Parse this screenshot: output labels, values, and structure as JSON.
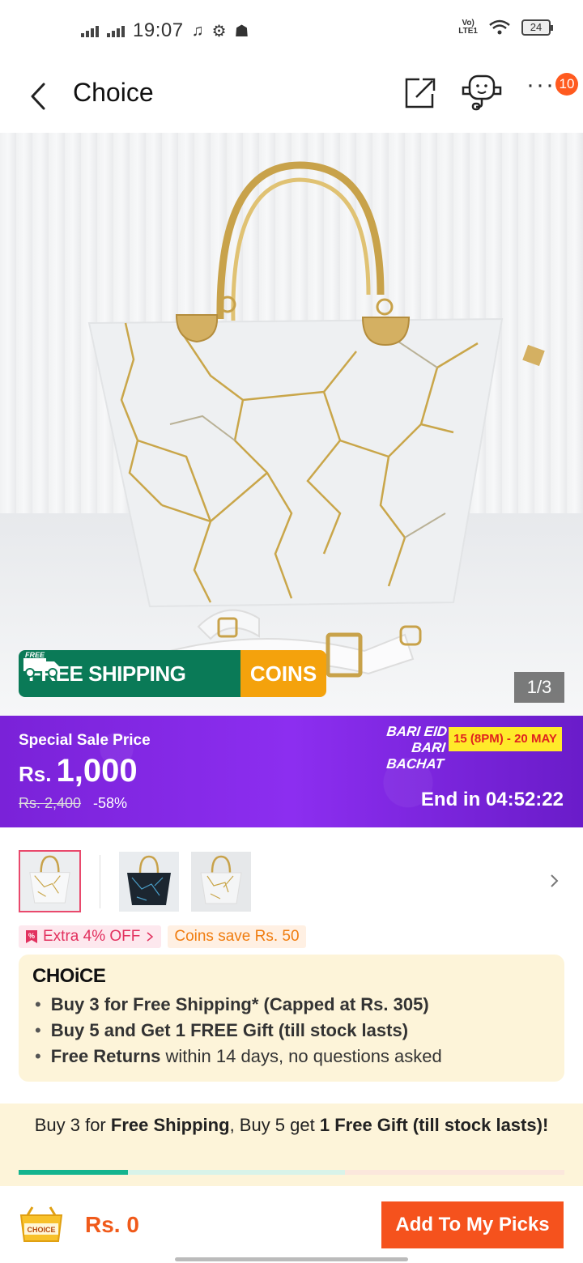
{
  "status_bar": {
    "time": "19:07",
    "network": "Vo)) LTE1",
    "battery": "24"
  },
  "header": {
    "title": "Choice",
    "notification_count": "10"
  },
  "gallery": {
    "counter": "1/3",
    "shipping_badge": {
      "tag": "FREE",
      "label": "FREE SHIPPING",
      "coins": "COINS"
    }
  },
  "sale": {
    "label": "Special Sale Price",
    "currency": "Rs.",
    "price": "1,000",
    "original_price": "Rs. 2,400",
    "discount": "-58%",
    "campaign_line1": "BARI EID",
    "campaign_line2": "BARI BACHAT",
    "campaign_dates": "15 (8PM) - 20 MAY",
    "end_prefix": "End in",
    "countdown": "04:52:22"
  },
  "promo_tags": {
    "extra_off": "Extra 4% OFF",
    "coins_save": "Coins save Rs. 50"
  },
  "choice_box": {
    "logo": "CHOiCE",
    "line1_bold": "Buy 3 for  Free Shipping* (Capped at Rs. 305)",
    "line2_bold": "Buy 5 and Get 1 FREE Gift (till stock lasts)",
    "line3_bold": "Free Returns",
    "line3_rest": " within 14 days, no questions asked"
  },
  "buy_banner": {
    "part1": "Buy 3 for ",
    "part2": "Free Shipping",
    "part3": ", Buy 5 get ",
    "part4": "1 Free Gift (till stock lasts)",
    "part5": "!",
    "progress": 0.2
  },
  "bottom_bar": {
    "cart_label": "CHOICE",
    "price": "Rs. 0",
    "cta": "Add To My Picks"
  },
  "colors": {
    "accent": "#f5521d",
    "sale_purple": "#8c2ef0",
    "shipping_green": "#0a7a57",
    "coins_orange": "#f4a20c"
  }
}
